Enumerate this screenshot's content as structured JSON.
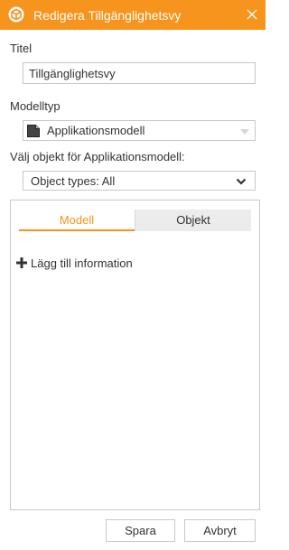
{
  "dialog": {
    "title": "Redigera Tillgänglighetsvy",
    "accent_color": "#f7941d",
    "icons": {
      "app": "box-icon",
      "close": "close-icon"
    }
  },
  "form": {
    "title_label": "Titel",
    "title_value": "Tillgänglighetsvy",
    "model_type_label": "Modelltyp",
    "model_type_value": "Applikationsmodell",
    "select_objects_label": "Välj objekt för Applikationsmodell:",
    "object_types_value": "Object types: All"
  },
  "tabs": [
    {
      "label": "Modell",
      "active": true
    },
    {
      "label": "Objekt",
      "active": false
    }
  ],
  "panel": {
    "add_info_label": "Lägg till information"
  },
  "buttons": {
    "save_label": "Spara",
    "cancel_label": "Avbryt"
  }
}
